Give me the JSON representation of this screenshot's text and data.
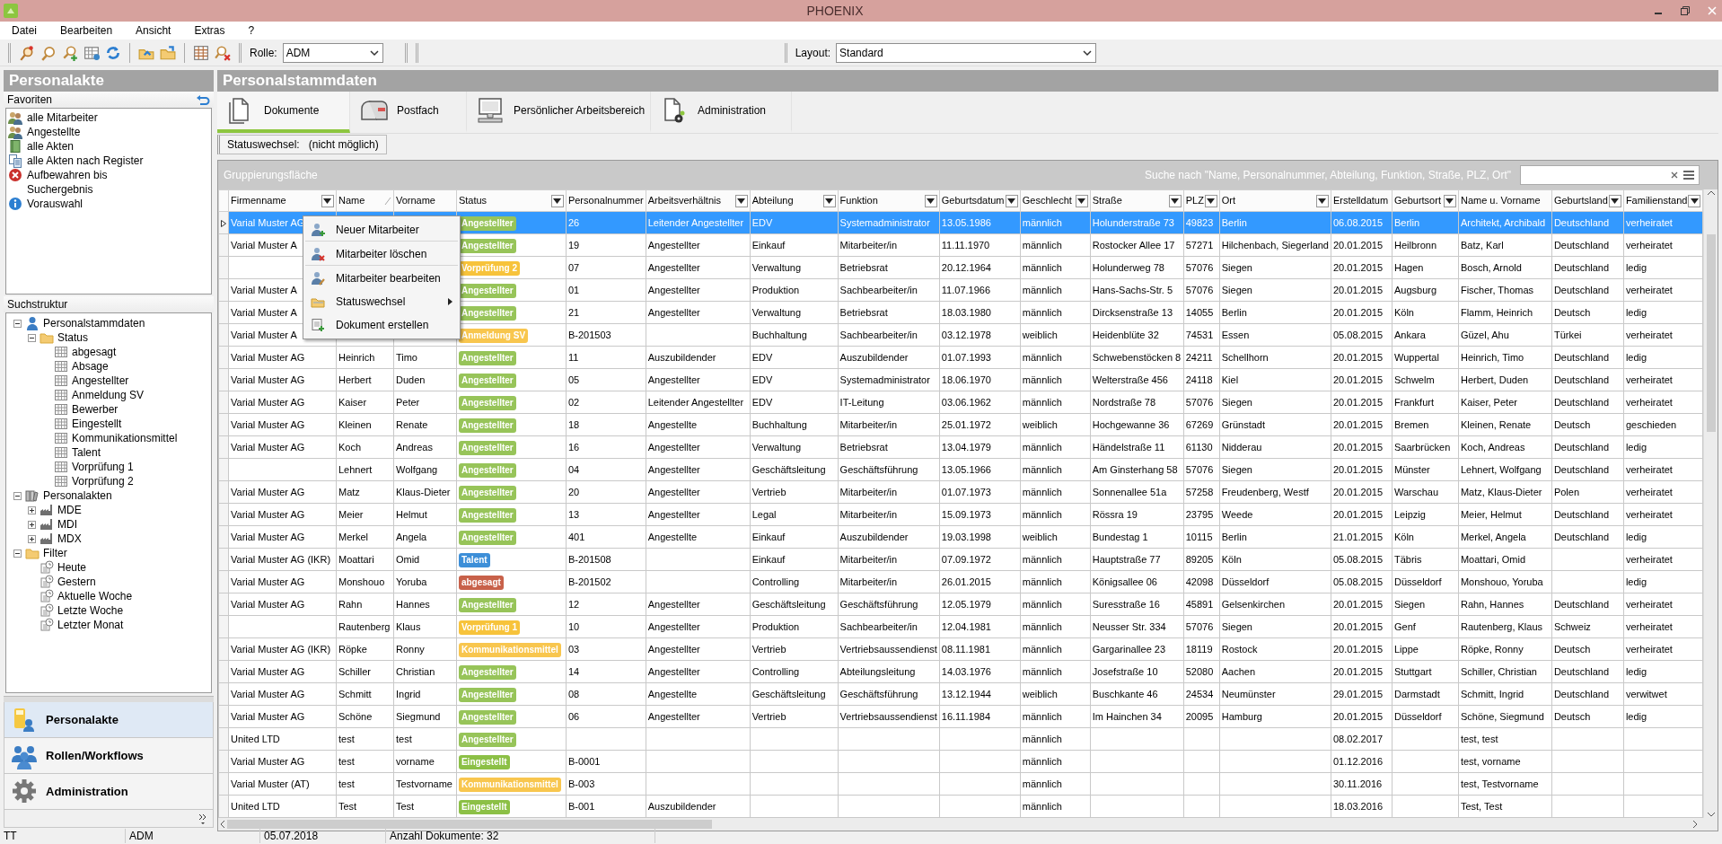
{
  "window": {
    "title": "PHOENIX"
  },
  "menu": [
    "Datei",
    "Bearbeiten",
    "Ansicht",
    "Extras",
    "?"
  ],
  "toolbar": {
    "role_label": "Rolle:",
    "role": "ADM",
    "layout_label": "Layout:",
    "layout": "Standard"
  },
  "sidebar": {
    "title": "Personalakte",
    "favorites_title": "Favoriten",
    "favorites": [
      {
        "label": "alle Mitarbeiter"
      },
      {
        "label": "Angestellte"
      },
      {
        "label": "alle Akten"
      },
      {
        "label": "alle Akten nach Register"
      },
      {
        "label": "Aufbewahren bis"
      },
      {
        "label": "Suchergebnis"
      },
      {
        "label": "Vorauswahl"
      }
    ],
    "tree_title": "Suchstruktur",
    "tree": [
      {
        "label": "Personalstammdaten",
        "kind": "person",
        "expanded": true,
        "children": [
          {
            "label": "Status",
            "kind": "folder",
            "expanded": true,
            "children": [
              {
                "label": "abgesagt",
                "kind": "table"
              },
              {
                "label": "Absage",
                "kind": "table"
              },
              {
                "label": "Angestellter",
                "kind": "table"
              },
              {
                "label": "Anmeldung SV",
                "kind": "table"
              },
              {
                "label": "Bewerber",
                "kind": "table"
              },
              {
                "label": "Eingestellt",
                "kind": "table"
              },
              {
                "label": "Kommunikationsmittel",
                "kind": "table"
              },
              {
                "label": "Talent",
                "kind": "table"
              },
              {
                "label": "Vorprüfung 1",
                "kind": "table"
              },
              {
                "label": "Vorprüfung 2",
                "kind": "table"
              }
            ]
          }
        ]
      },
      {
        "label": "Personalakten",
        "kind": "binders",
        "expanded": true,
        "children": [
          {
            "label": "MDE",
            "kind": "factory",
            "expanded": false
          },
          {
            "label": "MDI",
            "kind": "factory",
            "expanded": false
          },
          {
            "label": "MDX",
            "kind": "factory",
            "expanded": false
          }
        ]
      },
      {
        "label": "Filter",
        "kind": "folder",
        "expanded": true,
        "children": [
          {
            "label": "Heute",
            "kind": "clock"
          },
          {
            "label": "Gestern",
            "kind": "clock"
          },
          {
            "label": "Aktuelle Woche",
            "kind": "clock"
          },
          {
            "label": "Letzte Woche",
            "kind": "clock"
          },
          {
            "label": "Letzter Monat",
            "kind": "clock"
          }
        ]
      }
    ],
    "nav": [
      {
        "label": "Personalakte",
        "selected": true
      },
      {
        "label": "Rollen/Workflows",
        "selected": false
      },
      {
        "label": "Administration",
        "selected": false
      }
    ]
  },
  "main": {
    "title": "Personalstammdaten",
    "tabs": [
      {
        "label": "Dokumente",
        "selected": true
      },
      {
        "label": "Postfach",
        "selected": false
      },
      {
        "label": "Persönlicher Arbeitsbereich",
        "selected": false
      },
      {
        "label": "Administration",
        "selected": false
      }
    ],
    "status_change_label": "Statuswechsel:",
    "status_change_value": "(nicht möglich)",
    "grouping_area": "Gruppierungsfläche",
    "search_hint": "Suche nach \"Name, Personalnummer, Abteilung, Funktion, Straße, PLZ, Ort\""
  },
  "table": {
    "columns": [
      {
        "label": "Firmenname",
        "kind": "text",
        "filter": true,
        "sorted": false
      },
      {
        "label": "Name",
        "kind": "text",
        "filter": false,
        "sorted": true
      },
      {
        "label": "Vorname",
        "kind": "text",
        "filter": false,
        "sorted": false
      },
      {
        "label": "Status",
        "kind": "status",
        "filter": true,
        "sorted": false
      },
      {
        "label": "Personalnummer",
        "kind": "text",
        "filter": false,
        "sorted": false
      },
      {
        "label": "Arbeitsverhältnis",
        "kind": "text",
        "filter": true,
        "sorted": false
      },
      {
        "label": "Abteilung",
        "kind": "text",
        "filter": true,
        "sorted": false
      },
      {
        "label": "Funktion",
        "kind": "text",
        "filter": true,
        "sorted": false
      },
      {
        "label": "Geburtsdatum",
        "kind": "text",
        "filter": true,
        "sorted": false
      },
      {
        "label": "Geschlecht",
        "kind": "text",
        "filter": true,
        "sorted": false
      },
      {
        "label": "Straße",
        "kind": "text",
        "filter": true,
        "sorted": false
      },
      {
        "label": "PLZ",
        "kind": "text",
        "filter": true,
        "sorted": false
      },
      {
        "label": "Ort",
        "kind": "text",
        "filter": true,
        "sorted": false
      },
      {
        "label": "Erstelldatum",
        "kind": "text",
        "filter": false,
        "sorted": false
      },
      {
        "label": "Geburtsort",
        "kind": "text",
        "filter": true,
        "sorted": false
      },
      {
        "label": "Name u. Vorname",
        "kind": "text",
        "filter": false,
        "sorted": false
      },
      {
        "label": "Geburtsland",
        "kind": "text",
        "filter": true,
        "sorted": false
      },
      {
        "label": "Familienstand",
        "kind": "text",
        "filter": true,
        "sorted": false
      }
    ],
    "rows": [
      {
        "selected": true,
        "cells": [
          "Varial Muster AG",
          null,
          null,
          {
            "label": "Angestellter",
            "color": "#97c459"
          },
          "26",
          "Leitender Angestellter",
          "EDV",
          "Systemadministrator",
          "13.05.1986",
          "männlich",
          "Holunderstraße 73",
          "49823",
          "Berlin",
          "06.08.2015",
          "Berlin",
          "Architekt, Archibald",
          "Deutschland",
          "verheiratet"
        ]
      },
      {
        "selected": false,
        "cells": [
          "Varial Muster A",
          null,
          null,
          {
            "label": "Angestellter",
            "color": "#97c459"
          },
          "19",
          "Angestellter",
          "Einkauf",
          "Mitarbeiter/in",
          "11.11.1970",
          "männlich",
          "Rostocker Allee 17",
          "57271",
          "Hilchenbach, Siegerland",
          "20.01.2015",
          "Heilbronn",
          "Batz, Karl",
          "Deutschland",
          "verheiratet"
        ]
      },
      {
        "selected": false,
        "cells": [
          null,
          null,
          null,
          {
            "label": "Vorprüfung 2",
            "color": "#f7c33b"
          },
          "07",
          "Angestellter",
          "Verwaltung",
          "Betriebsrat",
          "20.12.1964",
          "männlich",
          "Holunderweg 78",
          "57076",
          "Siegen",
          "20.01.2015",
          "Hagen",
          "Bosch, Arnold",
          "Deutschland",
          "ledig"
        ]
      },
      {
        "selected": false,
        "cells": [
          "Varial Muster A",
          null,
          null,
          {
            "label": "Angestellter",
            "color": "#97c459"
          },
          "01",
          "Angestellter",
          "Produktion",
          "Sachbearbeiter/in",
          "11.07.1966",
          "männlich",
          "Hans-Sachs-Str. 5",
          "57076",
          "Siegen",
          "20.01.2015",
          "Augsburg",
          "Fischer, Thomas",
          "Deutschland",
          "verheiratet"
        ]
      },
      {
        "selected": false,
        "cells": [
          "Varial Muster A",
          null,
          null,
          {
            "label": "Angestellter",
            "color": "#97c459"
          },
          "21",
          "Angestellter",
          "Verwaltung",
          "Betriebsrat",
          "18.03.1980",
          "männlich",
          "Dircksenstraße 13",
          "14055",
          "Berlin",
          "20.01.2015",
          "Köln",
          "Flamm, Heinrich",
          "Deutsch",
          "ledig"
        ]
      },
      {
        "selected": false,
        "cells": [
          "Varial Muster A",
          null,
          null,
          {
            "label": "Anmeldung SV",
            "color": "#f8c64e"
          },
          "B-201503",
          null,
          "Buchhaltung",
          "Sachbearbeiter/in",
          "03.12.1978",
          "weiblich",
          "Heidenblüte 32",
          "74531",
          "Essen",
          "05.08.2015",
          "Ankara",
          "Güzel, Ahu",
          "Türkei",
          "verheiratet"
        ]
      },
      {
        "selected": false,
        "cells": [
          "Varial Muster AG",
          "Heinrich",
          "Timo",
          {
            "label": "Angestellter",
            "color": "#97c459"
          },
          "11",
          "Auszubildender",
          "EDV",
          "Auszubildender",
          "01.07.1993",
          "männlich",
          "Schwebenstöcken 8",
          "24211",
          "Schellhorn",
          "20.01.2015",
          "Wuppertal",
          "Heinrich, Timo",
          "Deutschland",
          "ledig"
        ]
      },
      {
        "selected": false,
        "cells": [
          "Varial Muster AG",
          "Herbert",
          "Duden",
          {
            "label": "Angestellter",
            "color": "#97c459"
          },
          "05",
          "Angestellter",
          "EDV",
          "Systemadministrator",
          "18.06.1970",
          "männlich",
          "Welterstraße 456",
          "24118",
          "Kiel",
          "20.01.2015",
          "Schwelm",
          "Herbert, Duden",
          "Deutschland",
          "verheiratet"
        ]
      },
      {
        "selected": false,
        "cells": [
          "Varial Muster AG",
          "Kaiser",
          "Peter",
          {
            "label": "Angestellter",
            "color": "#97c459"
          },
          "02",
          "Leitender Angestellter",
          "EDV",
          "IT-Leitung",
          "03.06.1962",
          "männlich",
          "Nordstraße 78",
          "57076",
          "Siegen",
          "20.01.2015",
          "Frankfurt",
          "Kaiser, Peter",
          "Deutschland",
          "verheiratet"
        ]
      },
      {
        "selected": false,
        "cells": [
          "Varial Muster AG",
          "Kleinen",
          "Renate",
          {
            "label": "Angestellter",
            "color": "#97c459"
          },
          "18",
          "Angestellte",
          "Buchhaltung",
          "Mitarbeiter/in",
          "25.01.1972",
          "weiblich",
          "Hochgewanne 36",
          "67269",
          "Grünstadt",
          "20.01.2015",
          "Bremen",
          "Kleinen, Renate",
          "Deutsch",
          "geschieden"
        ]
      },
      {
        "selected": false,
        "cells": [
          "Varial Muster AG",
          "Koch",
          "Andreas",
          {
            "label": "Angestellter",
            "color": "#97c459"
          },
          "16",
          "Angestellter",
          "Verwaltung",
          "Betriebsrat",
          "13.04.1979",
          "männlich",
          "Händelstraße 11",
          "61130",
          "Nidderau",
          "20.01.2015",
          "Saarbrücken",
          "Koch, Andreas",
          "Deutschland",
          "ledig"
        ]
      },
      {
        "selected": false,
        "cells": [
          null,
          "Lehnert",
          "Wolfgang",
          {
            "label": "Angestellter",
            "color": "#97c459"
          },
          "04",
          "Angestellter",
          "Geschäftsleitung",
          "Geschäftsführung",
          "13.05.1966",
          "männlich",
          "Am Ginsterhang 58",
          "57076",
          "Siegen",
          "20.01.2015",
          "Münster",
          "Lehnert, Wolfgang",
          "Deutschland",
          "verheiratet"
        ]
      },
      {
        "selected": false,
        "cells": [
          "Varial Muster AG",
          "Matz",
          "Klaus-Dieter",
          {
            "label": "Angestellter",
            "color": "#97c459"
          },
          "20",
          "Angestellter",
          "Vertrieb",
          "Mitarbeiter/in",
          "01.07.1973",
          "männlich",
          "Sonnenallee 51a",
          "57258",
          "Freudenberg, Westf",
          "20.01.2015",
          "Warschau",
          "Matz, Klaus-Dieter",
          "Polen",
          "verheiratet"
        ]
      },
      {
        "selected": false,
        "cells": [
          "Varial Muster AG",
          "Meier",
          "Helmut",
          {
            "label": "Angestellter",
            "color": "#97c459"
          },
          "13",
          "Angestellter",
          "Legal",
          "Mitarbeiter/in",
          "15.09.1973",
          "männlich",
          "Rössra 19",
          "23795",
          "Weede",
          "20.01.2015",
          "Leipzig",
          "Meier, Helmut",
          "Deutschland",
          "verheiratet"
        ]
      },
      {
        "selected": false,
        "cells": [
          "Varial Muster AG",
          "Merkel",
          "Angela",
          {
            "label": "Angestellter",
            "color": "#97c459"
          },
          "401",
          "Angestellte",
          "Einkauf",
          "Auszubildender",
          "19.03.1998",
          "weiblich",
          "Bundestag 1",
          "10115",
          "Berlin",
          "21.01.2015",
          "Köln",
          "Merkel, Angela",
          "Deutschland",
          "ledig"
        ]
      },
      {
        "selected": false,
        "cells": [
          "Varial Muster AG (IKR)",
          "Moattari",
          "Omid",
          {
            "label": "Talent",
            "color": "#3d8fd8"
          },
          "B-201508",
          null,
          "Einkauf",
          "Mitarbeiter/in",
          "07.09.1972",
          "männlich",
          "Hauptstraße 77",
          "89205",
          "Köln",
          "05.08.2015",
          "Täbris",
          "Moattari, Omid",
          null,
          "verheiratet"
        ]
      },
      {
        "selected": false,
        "cells": [
          "Varial Muster AG",
          "Monshouo",
          "Yoruba",
          {
            "label": "abgesagt",
            "color": "#c8614a"
          },
          "B-201502",
          null,
          "Controlling",
          "Mitarbeiter/in",
          "26.01.2015",
          "männlich",
          "Königsallee 06",
          "42098",
          "Düsseldorf",
          "05.08.2015",
          "Düsseldorf",
          "Monshouo, Yoruba",
          null,
          "ledig"
        ]
      },
      {
        "selected": false,
        "cells": [
          "Varial Muster AG",
          "Rahn",
          "Hannes",
          {
            "label": "Angestellter",
            "color": "#97c459"
          },
          "12",
          "Angestellter",
          "Geschäftsleitung",
          "Geschäftsführung",
          "12.05.1979",
          "männlich",
          "Suresstraße 16",
          "45891",
          "Gelsenkirchen",
          "20.01.2015",
          "Siegen",
          "Rahn, Hannes",
          "Deutschland",
          "verheiratet"
        ]
      },
      {
        "selected": false,
        "cells": [
          null,
          "Rautenberg",
          "Klaus",
          {
            "label": "Vorprüfung 1",
            "color": "#f7c33b"
          },
          "10",
          "Angestellter",
          "Produktion",
          "Sachbearbeiter/in",
          "12.04.1981",
          "männlich",
          "Neusser Str. 334",
          "57076",
          "Siegen",
          "20.01.2015",
          "Genf",
          "Rautenberg, Klaus",
          "Schweiz",
          "verheiratet"
        ]
      },
      {
        "selected": false,
        "cells": [
          "Varial Muster AG (IKR)",
          "Röpke",
          "Ronny",
          {
            "label": "Kommunikationsmittel",
            "color": "#f8c64e"
          },
          "03",
          "Angestellter",
          "Vertrieb",
          "Vertriebsaussendienst",
          "08.11.1981",
          "männlich",
          "Gargarinallee 23",
          "18119",
          "Rostock",
          "20.01.2015",
          "Lippe",
          "Röpke, Ronny",
          "Deutsch",
          "verheiratet"
        ]
      },
      {
        "selected": false,
        "cells": [
          "Varial Muster AG",
          "Schiller",
          "Christian",
          {
            "label": "Angestellter",
            "color": "#97c459"
          },
          "14",
          "Angestellter",
          "Controlling",
          "Abteilungsleitung",
          "14.03.1976",
          "männlich",
          "Josefstraße 10",
          "52080",
          "Aachen",
          "20.01.2015",
          "Stuttgart",
          "Schiller, Christian",
          "Deutschland",
          "ledig"
        ]
      },
      {
        "selected": false,
        "cells": [
          "Varial Muster AG",
          "Schmitt",
          "Ingrid",
          {
            "label": "Angestellter",
            "color": "#97c459"
          },
          "08",
          "Angestellte",
          "Geschäftsleitung",
          "Geschäftsführung",
          "13.12.1944",
          "weiblich",
          "Buschkante 46",
          "24534",
          "Neumünster",
          "29.01.2015",
          "Darmstadt",
          "Schmitt, Ingrid",
          "Deutschland",
          "verwitwet"
        ]
      },
      {
        "selected": false,
        "cells": [
          "Varial Muster AG",
          "Schöne",
          "Siegmund",
          {
            "label": "Angestellter",
            "color": "#97c459"
          },
          "06",
          "Angestellter",
          "Vertrieb",
          "Vertriebsaussendienst",
          "16.11.1984",
          "männlich",
          "Im Hainchen 34",
          "20095",
          "Hamburg",
          "20.01.2015",
          "Düsseldorf",
          "Schöne, Siegmund",
          "Deutsch",
          "ledig"
        ]
      },
      {
        "selected": false,
        "cells": [
          "United LTD",
          "test",
          "test",
          {
            "label": "Angestellter",
            "color": "#97c459"
          },
          null,
          null,
          null,
          null,
          null,
          "männlich",
          null,
          null,
          null,
          "08.02.2017",
          null,
          "test, test",
          null,
          null
        ]
      },
      {
        "selected": false,
        "cells": [
          "Varial Muster AG",
          "test",
          "vorname",
          {
            "label": "Eingestellt",
            "color": "#8cc046"
          },
          "B-0001",
          null,
          null,
          null,
          null,
          "männlich",
          null,
          null,
          null,
          "01.12.2016",
          null,
          "test, vorname",
          null,
          null
        ]
      },
      {
        "selected": false,
        "cells": [
          "Varial Muster (AT)",
          "test",
          "Testvorname",
          {
            "label": "Kommunikationsmittel",
            "color": "#f8c64e"
          },
          "B-003",
          null,
          null,
          null,
          null,
          "männlich",
          null,
          null,
          null,
          "30.11.2016",
          null,
          "test, Testvorname",
          null,
          null
        ]
      },
      {
        "selected": false,
        "cells": [
          "United LTD",
          "Test",
          "Test",
          {
            "label": "Eingestellt",
            "color": "#8cc046"
          },
          "B-001",
          "Auszubildender",
          null,
          null,
          null,
          "männlich",
          null,
          null,
          null,
          "18.03.2016",
          null,
          "Test, Test",
          null,
          null
        ]
      }
    ]
  },
  "context_menu": [
    {
      "label": "Neuer Mitarbeiter",
      "submenu": false,
      "separator_after": true
    },
    {
      "label": "Mitarbeiter löschen",
      "submenu": false,
      "separator_after": true
    },
    {
      "label": "Mitarbeiter bearbeiten",
      "submenu": false,
      "separator_after": false
    },
    {
      "label": "Statuswechsel",
      "submenu": true,
      "separator_after": false
    },
    {
      "label": "Dokument erstellen",
      "submenu": false,
      "separator_after": false
    }
  ],
  "status_bar": [
    "TT",
    "ADM",
    "05.07.2018",
    "Anzahl Dokumente: 32"
  ]
}
